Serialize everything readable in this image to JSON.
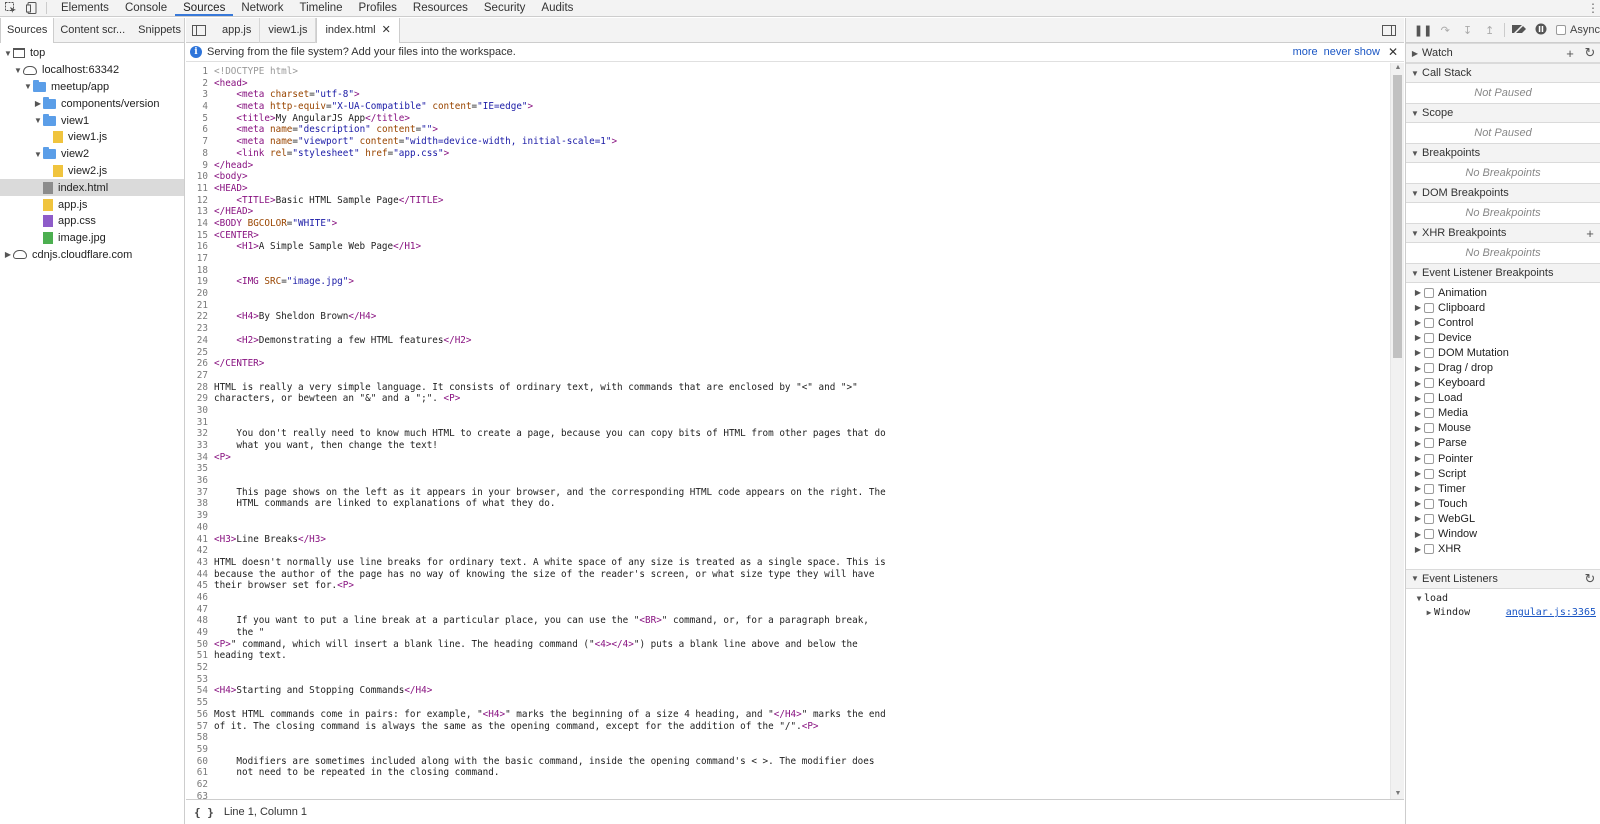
{
  "toolbar": {
    "tabs": [
      "Elements",
      "Console",
      "Sources",
      "Network",
      "Timeline",
      "Profiles",
      "Resources",
      "Security",
      "Audits"
    ],
    "active_tab": "Sources",
    "icons": [
      "inspect-icon",
      "device-mode-icon",
      "kebab-menu-icon"
    ]
  },
  "navigator": {
    "tabs": [
      "Sources",
      "Content scr...",
      "Snippets"
    ],
    "active_tab": "Sources",
    "tree": [
      {
        "label": "top",
        "depth": 0,
        "expanded": true,
        "icon": "frame-icon"
      },
      {
        "label": "localhost:63342",
        "depth": 1,
        "expanded": true,
        "icon": "cloud-icon"
      },
      {
        "label": "meetup/app",
        "depth": 2,
        "expanded": true,
        "icon": "folder-icon"
      },
      {
        "label": "components/version",
        "depth": 3,
        "expanded": false,
        "icon": "folder-icon"
      },
      {
        "label": "view1",
        "depth": 3,
        "expanded": true,
        "icon": "folder-icon"
      },
      {
        "label": "view1.js",
        "depth": 4,
        "icon": "js-file-icon"
      },
      {
        "label": "view2",
        "depth": 3,
        "expanded": true,
        "icon": "folder-icon"
      },
      {
        "label": "view2.js",
        "depth": 4,
        "icon": "js-file-icon"
      },
      {
        "label": "index.html",
        "depth": 3,
        "icon": "html-file-icon",
        "selected": true
      },
      {
        "label": "app.js",
        "depth": 3,
        "icon": "js-file-icon"
      },
      {
        "label": "app.css",
        "depth": 3,
        "icon": "css-file-icon"
      },
      {
        "label": "image.jpg",
        "depth": 3,
        "icon": "image-file-icon"
      },
      {
        "label": "cdnjs.cloudflare.com",
        "depth": 0,
        "expanded": false,
        "icon": "cloud-icon"
      }
    ]
  },
  "editor": {
    "tabs": [
      {
        "label": "app.js",
        "active": false
      },
      {
        "label": "view1.js",
        "active": false
      },
      {
        "label": "index.html",
        "active": true
      }
    ],
    "infobar": {
      "message": "Serving from the file system? Add your files into the workspace.",
      "more": "more",
      "never_show": "never show"
    },
    "status": "Line 1, Column 1",
    "pretty_print": "{ }",
    "lines": [
      "<!DOCTYPE html>",
      "<head>",
      "    <meta charset=\"utf-8\">",
      "    <meta http-equiv=\"X-UA-Compatible\" content=\"IE=edge\">",
      "    <title>My AngularJS App</title>",
      "    <meta name=\"description\" content=\"\">",
      "    <meta name=\"viewport\" content=\"width=device-width, initial-scale=1\">",
      "    <link rel=\"stylesheet\" href=\"app.css\">",
      "</head>",
      "<body>",
      "<HEAD>",
      "    <TITLE>Basic HTML Sample Page</TITLE>",
      "</HEAD>",
      "<BODY BGCOLOR=\"WHITE\">",
      "<CENTER>",
      "    <H1>A Simple Sample Web Page</H1>",
      "",
      "",
      "    <IMG SRC=\"image.jpg\">",
      "",
      "",
      "    <H4>By Sheldon Brown</H4>",
      "",
      "    <H2>Demonstrating a few HTML features</H2>",
      "",
      "</CENTER>",
      "",
      "HTML is really a very simple language. It consists of ordinary text, with commands that are enclosed by \"<\" and \">\"",
      "characters, or bewteen an \"&\" and a \";\". <P>",
      "",
      "",
      "    You don't really need to know much HTML to create a page, because you can copy bits of HTML from other pages that do",
      "    what you want, then change the text!",
      "<P>",
      "",
      "",
      "    This page shows on the left as it appears in your browser, and the corresponding HTML code appears on the right. The",
      "    HTML commands are linked to explanations of what they do.",
      "",
      "",
      "<H3>Line Breaks</H3>",
      "",
      "HTML doesn't normally use line breaks for ordinary text. A white space of any size is treated as a single space. This is",
      "because the author of the page has no way of knowing the size of the reader's screen, or what size type they will have",
      "their browser set for.<P>",
      "",
      "",
      "    If you want to put a line break at a particular place, you can use the \"<BR>\" command, or, for a paragraph break,",
      "    the \"",
      "<P>\" command, which will insert a blank line. The heading command (\"<4></4>\") puts a blank line above and below the",
      "heading text.",
      "",
      "",
      "<H4>Starting and Stopping Commands</H4>",
      "",
      "Most HTML commands come in pairs: for example, \"<H4>\" marks the beginning of a size 4 heading, and \"</H4>\" marks the end",
      "of it. The closing command is always the same as the opening command, except for the addition of the \"/\".<P>",
      "",
      "",
      "    Modifiers are sometimes included along with the basic command, inside the opening command's < >. The modifier does",
      "    not need to be repeated in the closing command.",
      "",
      ""
    ]
  },
  "sidebar": {
    "async_label": "Async",
    "watch": "Watch",
    "call_stack": "Call Stack",
    "call_stack_empty": "Not Paused",
    "scope": "Scope",
    "scope_empty": "Not Paused",
    "breakpoints": "Breakpoints",
    "breakpoints_empty": "No Breakpoints",
    "dom_breakpoints": "DOM Breakpoints",
    "dom_breakpoints_empty": "No Breakpoints",
    "xhr_breakpoints": "XHR Breakpoints",
    "xhr_breakpoints_empty": "No Breakpoints",
    "event_listener_breakpoints": "Event Listener Breakpoints",
    "event_categories": [
      "Animation",
      "Clipboard",
      "Control",
      "Device",
      "DOM Mutation",
      "Drag / drop",
      "Keyboard",
      "Load",
      "Media",
      "Mouse",
      "Parse",
      "Pointer",
      "Script",
      "Timer",
      "Touch",
      "WebGL",
      "Window",
      "XHR"
    ],
    "event_listeners": "Event Listeners",
    "listener_event": "load",
    "listener_target": "Window",
    "listener_source": "angular.js:3365"
  },
  "colors": {
    "accent": "#3879d9",
    "tag": "#881280",
    "attr_name": "#994500",
    "attr_value": "#1a1aa6",
    "comment": "#999999",
    "link": "#1a56c4"
  }
}
